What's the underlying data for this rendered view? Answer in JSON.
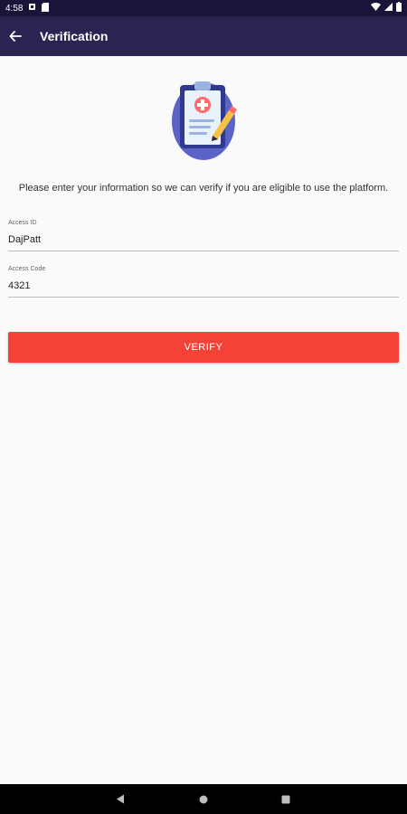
{
  "status_bar": {
    "time": "4:58",
    "icons_left": [
      "notification-icon",
      "sd-card-icon"
    ],
    "icons_right": [
      "wifi-icon",
      "signal-icon",
      "battery-icon"
    ]
  },
  "app_bar": {
    "title": "Verification",
    "back_icon": "arrow-back-icon"
  },
  "main": {
    "illustration": "clipboard-medical-icon",
    "intro_text": "Please enter your information so we can verify if you are eligible to use the platform.",
    "fields": [
      {
        "label": "Access ID",
        "value": "DajPatt"
      },
      {
        "label": "Access Code",
        "value": "4321"
      }
    ],
    "verify_label": "VERIFY"
  },
  "nav_bar": {
    "buttons": [
      "back-triangle-icon",
      "home-circle-icon",
      "recents-square-icon"
    ]
  },
  "colors": {
    "status_bar": "#1a1538",
    "app_bar": "#2b2351",
    "accent": "#f44336",
    "background": "#fafafa"
  }
}
